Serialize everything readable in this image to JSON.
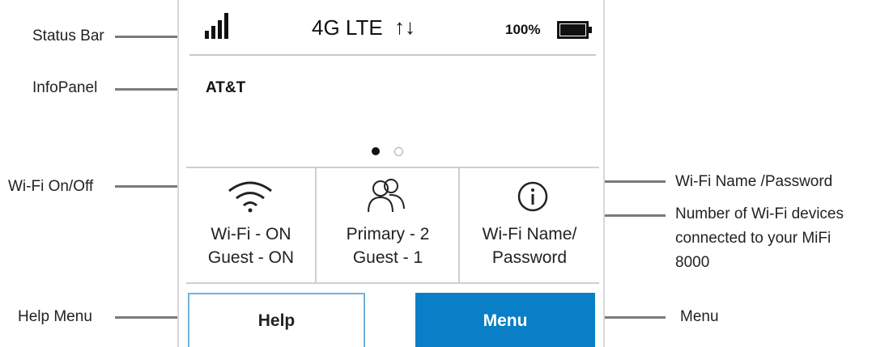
{
  "callouts": {
    "status_bar": "Status Bar",
    "info_panel": "InfoPanel",
    "wifi_on_off": "Wi-Fi On/Off",
    "help_menu": "Help Menu",
    "wifi_name_password": "Wi-Fi Name /Password",
    "devices_line1": "Number of Wi-Fi devices",
    "devices_line2": "connected to your MiFi",
    "devices_line3": "8000",
    "menu": "Menu"
  },
  "status_bar": {
    "signal_icon": "signal-bars-icon",
    "network": "4G LTE",
    "data_icon": "up-down-arrows-icon",
    "data_glyph": "↑↓",
    "battery_percent": "100%",
    "battery_level": 1.0,
    "battery_icon": "battery-full-icon"
  },
  "info_panel": {
    "carrier": "AT&T",
    "page_count": 2,
    "current_page": 1
  },
  "tiles": [
    {
      "icon": "wifi-icon",
      "line1": "Wi-Fi - ON",
      "line2": "Guest - ON"
    },
    {
      "icon": "users-icon",
      "line1": "Primary - 2",
      "line2": "Guest - 1"
    },
    {
      "icon": "info-icon",
      "line1": "Wi-Fi Name/",
      "line2": "Password"
    }
  ],
  "buttons": {
    "help": "Help",
    "menu": "Menu"
  },
  "colors": {
    "menu_button": "#0a7fc8",
    "help_border": "#6fb2df",
    "callout_line": "#7a7a7a"
  }
}
